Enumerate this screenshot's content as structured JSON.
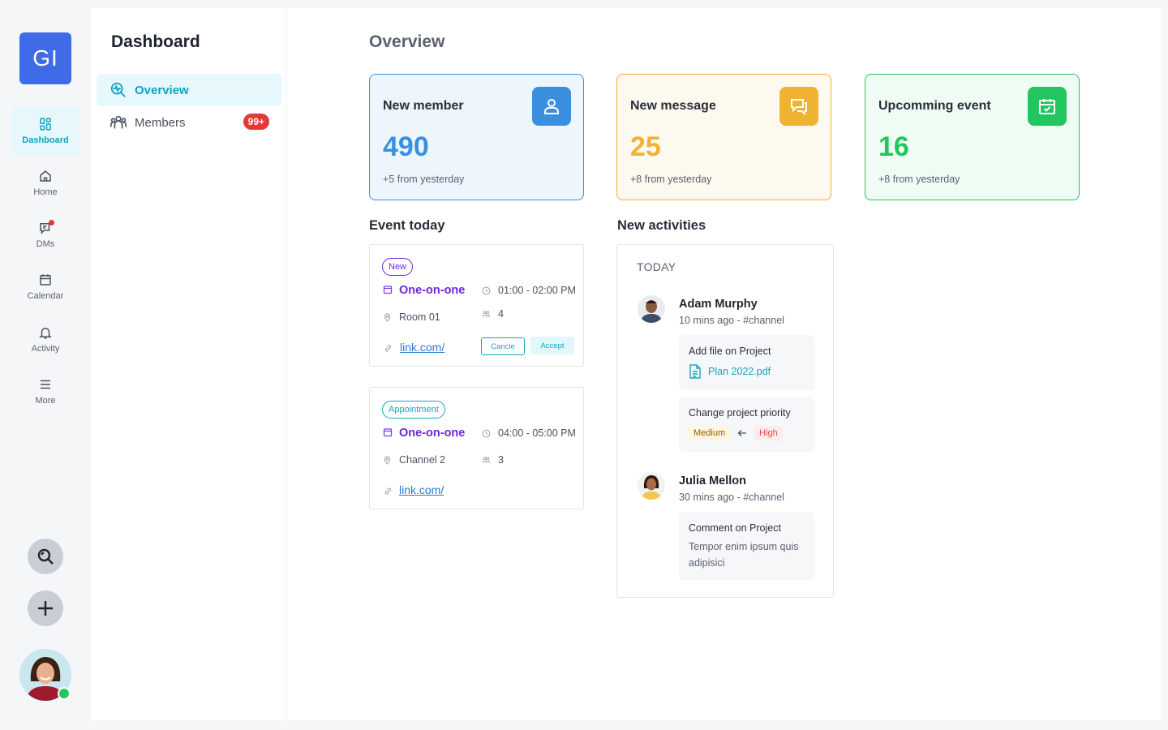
{
  "rail": {
    "logo": "GI",
    "items": [
      {
        "label": "Dashboard",
        "icon": "dashboard-icon"
      },
      {
        "label": "Home",
        "icon": "home-icon"
      },
      {
        "label": "DMs",
        "icon": "chat-icon"
      },
      {
        "label": "Calendar",
        "icon": "calendar-icon"
      },
      {
        "label": "Activity",
        "icon": "bell-icon"
      },
      {
        "label": "More",
        "icon": "menu-icon"
      }
    ]
  },
  "subnav": {
    "title": "Dashboard",
    "items": [
      {
        "label": "Overview",
        "icon": "overview-icon"
      },
      {
        "label": "Members",
        "icon": "members-icon",
        "badge": "99+"
      }
    ]
  },
  "main": {
    "title": "Overview",
    "stats": [
      {
        "title": "New member",
        "value": "490",
        "sub": "+5 from yesterday",
        "icon": "user-icon",
        "accent": "#3b8fdf"
      },
      {
        "title": "New message",
        "value": "25",
        "sub": "+8 from yesterday",
        "icon": "message-icon",
        "accent": "#f0b233"
      },
      {
        "title": "Upcomming event",
        "value": "16",
        "sub": "+8 from yesterday",
        "icon": "calendar-check-icon",
        "accent": "#22c55e"
      }
    ],
    "events_title": "Event today",
    "events": [
      {
        "tag": "New",
        "title": "One-on-one",
        "time": "01:00 - 02:00 PM",
        "location": "Room 01",
        "people": "4",
        "link": "link.com/",
        "cancel": "Cancle",
        "accept": "Accept"
      },
      {
        "tag": "Appointment",
        "title": "One-on-one",
        "time": "04:00 - 05:00 PM",
        "location": "Channel 2",
        "people": "3",
        "link": "link.com/"
      }
    ],
    "activities_title": "New activities",
    "activities": {
      "group": "TODAY",
      "items": [
        {
          "name": "Adam Murphy",
          "meta": "10 mins ago - #channel",
          "entries": [
            {
              "text": "Add file on Project",
              "file": "Plan 2022.pdf"
            },
            {
              "text": "Change project priority",
              "from": "Medium",
              "to": "High"
            }
          ]
        },
        {
          "name": "Julia Mellon",
          "meta": "30 mins ago - #channel",
          "entries": [
            {
              "text": "Comment on Project",
              "comment": "Tempor enim ipsum quis adipisici"
            }
          ]
        }
      ]
    }
  }
}
